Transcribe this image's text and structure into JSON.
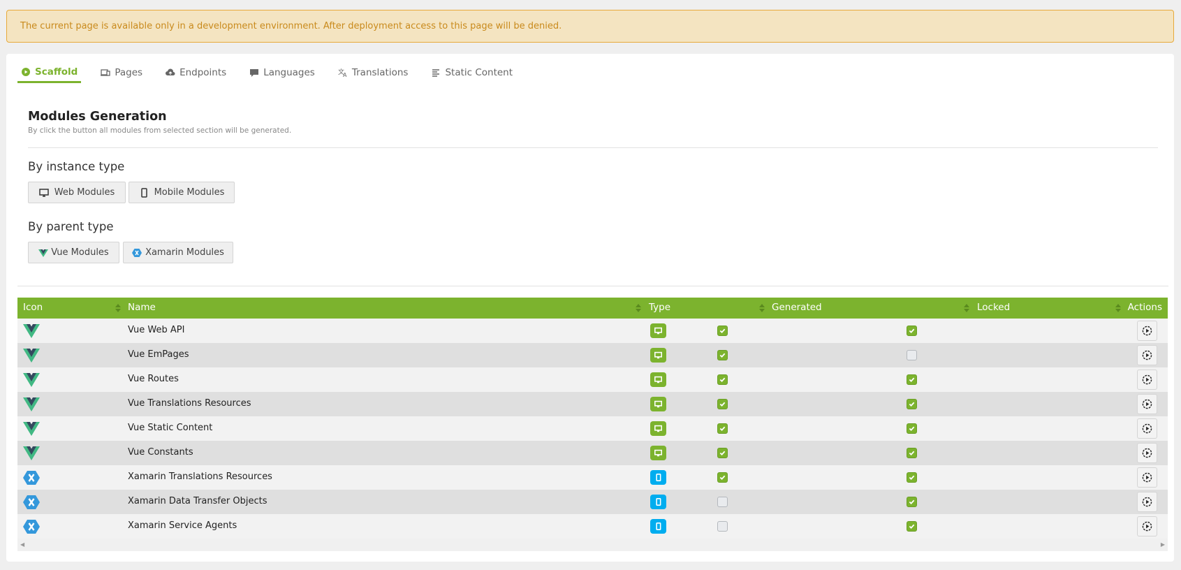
{
  "banner": "The current page is available only in a development environment. After deployment access to this page will be denied.",
  "tabs": [
    {
      "label": "Scaffold",
      "icon": "play-circle-icon"
    },
    {
      "label": "Pages",
      "icon": "devices-icon"
    },
    {
      "label": "Endpoints",
      "icon": "cloud-upload-icon"
    },
    {
      "label": "Languages",
      "icon": "comment-icon"
    },
    {
      "label": "Translations",
      "icon": "translate-icon"
    },
    {
      "label": "Static Content",
      "icon": "text-lines-icon"
    }
  ],
  "section": {
    "title": "Modules Generation",
    "subtitle": "By click the button all modules from selected section will be generated.",
    "by_instance": "By instance type",
    "by_parent": "By parent type",
    "web": "Web Modules",
    "mobile": "Mobile Modules",
    "vue": "Vue Modules",
    "xamarin": "Xamarin Modules"
  },
  "table": {
    "headers": [
      "Icon",
      "Name",
      "Type",
      "Generated",
      "Locked",
      "Actions"
    ],
    "rows": [
      {
        "icon": "vue",
        "name": "Vue Web API",
        "type": "web",
        "generated": true,
        "locked": true
      },
      {
        "icon": "vue",
        "name": "Vue EmPages",
        "type": "web",
        "generated": true,
        "locked": false
      },
      {
        "icon": "vue",
        "name": "Vue Routes",
        "type": "web",
        "generated": true,
        "locked": true
      },
      {
        "icon": "vue",
        "name": "Vue Translations Resources",
        "type": "web",
        "generated": true,
        "locked": true
      },
      {
        "icon": "vue",
        "name": "Vue Static Content",
        "type": "web",
        "generated": true,
        "locked": true
      },
      {
        "icon": "vue",
        "name": "Vue Constants",
        "type": "web",
        "generated": true,
        "locked": true
      },
      {
        "icon": "xamarin",
        "name": "Xamarin Translations Resources",
        "type": "mobile",
        "generated": true,
        "locked": true
      },
      {
        "icon": "xamarin",
        "name": "Xamarin Data Transfer Objects",
        "type": "mobile",
        "generated": false,
        "locked": true
      },
      {
        "icon": "xamarin",
        "name": "Xamarin Service Agents",
        "type": "mobile",
        "generated": false,
        "locked": true
      }
    ]
  },
  "colors": {
    "accent": "#7cb32e",
    "mobile": "#00adef",
    "web": "#7cb32e"
  }
}
